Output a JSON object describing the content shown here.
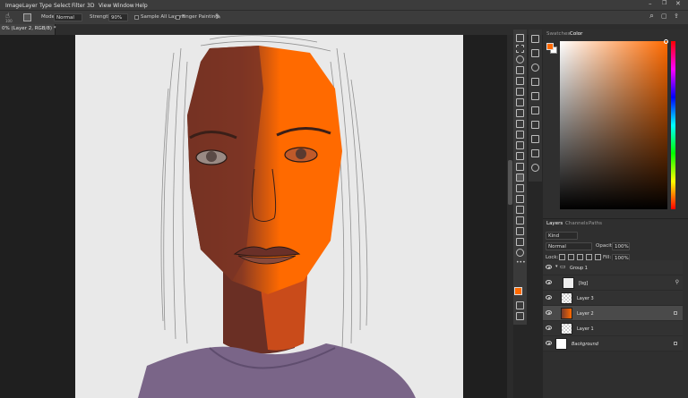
{
  "menubar": {
    "items": [
      "Image",
      "Layer",
      "Type",
      "Select",
      "Filter",
      "3D",
      "View",
      "Window",
      "Help"
    ]
  },
  "options": {
    "mode_label": "Mode:",
    "mode_value": "Normal",
    "strength_label": "Strength:",
    "strength_value": "90%",
    "sample_all_layers": "Sample All Layers",
    "finger_painting": "Finger Painting",
    "brush_size": "100"
  },
  "document": {
    "tab_title": "0% (Layer 2, RGB/8) *"
  },
  "swatches_panel": {
    "tabs": [
      "Swatches",
      "Color"
    ],
    "active_tab": "Color"
  },
  "colors": {
    "foreground": "#ff6a00",
    "background": "#ffffff",
    "accent": "#ff6a00"
  },
  "layers_panel": {
    "tabs": [
      "Layers",
      "Channels",
      "Paths"
    ],
    "filter_kind": "Kind",
    "blend_mode": "Normal",
    "opacity_label": "Opacity:",
    "opacity_value": "100%",
    "lock_label": "Lock:",
    "fill_label": "Fill:",
    "fill_value": "100%",
    "layers": [
      {
        "name": "Group 1",
        "type": "group",
        "selected": false,
        "locked": false
      },
      {
        "name": "[bg]",
        "type": "smart",
        "selected": false,
        "locked": false
      },
      {
        "name": "Layer 3",
        "type": "pixel",
        "selected": false,
        "locked": false
      },
      {
        "name": "Layer 2",
        "type": "pixel",
        "selected": true,
        "locked": true
      },
      {
        "name": "Layer 1",
        "type": "pixel",
        "selected": false,
        "locked": false
      },
      {
        "name": "Background",
        "type": "background",
        "selected": false,
        "locked": true
      }
    ]
  },
  "icons": [
    "ps-home-icon",
    "smudge-tool-icon",
    "brush-angle-icon",
    "search-icon",
    "workspace-icon",
    "share-icon",
    "move-tool-icon",
    "marquee-tool-icon",
    "lasso-tool-icon",
    "crop-tool-icon",
    "eyedropper-tool-icon",
    "brush-tool-icon",
    "eraser-tool-icon",
    "text-tool-icon",
    "zoom-tool-icon",
    "eye-icon",
    "lock-icon",
    "folder-icon"
  ]
}
